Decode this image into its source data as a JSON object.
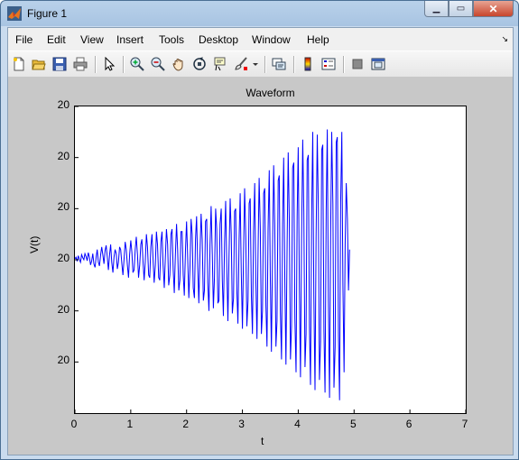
{
  "window": {
    "title": "Figure 1",
    "minimize_label": "▁",
    "maximize_label": "▭",
    "close_label": "✕"
  },
  "menu": {
    "items": [
      "File",
      "Edit",
      "View",
      "Insert",
      "Tools",
      "Desktop",
      "Window",
      "Help"
    ]
  },
  "toolbar": {
    "icons": [
      "new-figure-icon",
      "open-file-icon",
      "save-icon",
      "print-icon",
      "pointer-icon",
      "zoom-in-icon",
      "zoom-out-icon",
      "pan-icon",
      "rotate-3d-icon",
      "data-cursor-icon",
      "brush-icon",
      "link-plot-icon",
      "colorbar-icon",
      "legend-icon",
      "hide-plot-tools-icon",
      "show-plot-tools-icon"
    ]
  },
  "colors": {
    "line": "#0000ff",
    "figure_bg": "#c8c8c8",
    "axes_bg": "#ffffff"
  },
  "chart_data": {
    "type": "line",
    "title": "Waveform",
    "xlabel": "t",
    "ylabel": "V(t)",
    "xlim": [
      0,
      7
    ],
    "ylim": [
      -3,
      3
    ],
    "xticks": [
      "0",
      "1",
      "2",
      "3",
      "4",
      "5",
      "6",
      "7"
    ],
    "yticks": [
      "20",
      "20",
      "20",
      "20",
      "20",
      "20"
    ],
    "series": [
      {
        "color": "#0000ff",
        "x_start": 0,
        "x_step": 0.02,
        "values": [
          0.02,
          0.05,
          -0.03,
          0.08,
          0.01,
          -0.05,
          0.1,
          0.04,
          0.0,
          0.12,
          0.06,
          -0.02,
          0.14,
          0.05,
          -0.1,
          -0.02,
          0.12,
          -0.08,
          -0.15,
          0.05,
          0.2,
          -0.05,
          -0.12,
          0.1,
          0.25,
          0.1,
          -0.08,
          0.18,
          0.28,
          0.05,
          -0.2,
          0.1,
          0.3,
          -0.05,
          -0.25,
          0.05,
          0.2,
          0.12,
          -0.18,
          -0.05,
          0.25,
          0.2,
          -0.08,
          -0.3,
          0.0,
          0.35,
          0.2,
          -0.1,
          -0.35,
          0.1,
          0.38,
          0.15,
          -0.25,
          -0.2,
          0.2,
          0.45,
          0.1,
          -0.35,
          -0.1,
          0.3,
          0.4,
          -0.05,
          -0.4,
          -0.05,
          0.5,
          0.25,
          -0.3,
          -0.35,
          0.25,
          0.5,
          0.0,
          -0.45,
          -0.1,
          0.55,
          0.3,
          -0.35,
          -0.4,
          0.35,
          0.55,
          -0.1,
          -0.55,
          0.05,
          0.6,
          0.3,
          -0.5,
          -0.3,
          0.5,
          0.6,
          -0.2,
          -0.65,
          0.1,
          0.7,
          0.2,
          -0.6,
          -0.4,
          0.55,
          0.55,
          -0.3,
          -0.7,
          0.2,
          0.75,
          0.0,
          -0.75,
          -0.2,
          0.8,
          0.5,
          -0.55,
          -0.75,
          0.4,
          0.85,
          -0.15,
          -0.85,
          0.15,
          0.9,
          0.4,
          -0.8,
          -0.6,
          0.75,
          0.8,
          -0.45,
          -1.0,
          0.3,
          1.05,
          0.1,
          -0.95,
          -0.35,
          1.0,
          0.6,
          -0.85,
          -0.8,
          0.7,
          1.0,
          -0.4,
          -1.1,
          0.35,
          1.15,
          -0.2,
          -1.2,
          0.05,
          1.2,
          0.5,
          -1.05,
          -0.75,
          0.95,
          1.0,
          -0.6,
          -1.25,
          0.4,
          1.3,
          -0.25,
          -1.35,
          0.1,
          1.4,
          0.45,
          -1.3,
          -0.8,
          1.1,
          1.2,
          -0.7,
          -1.45,
          0.55,
          1.5,
          -0.35,
          -1.55,
          0.15,
          1.6,
          0.6,
          -1.45,
          -1.0,
          1.3,
          1.4,
          -0.9,
          -1.7,
          0.6,
          1.75,
          -0.4,
          -1.8,
          0.25,
          1.85,
          0.7,
          -1.7,
          -1.2,
          1.55,
          1.65,
          -1.0,
          -1.95,
          0.7,
          2.0,
          -0.45,
          -2.05,
          0.3,
          2.1,
          0.8,
          -1.95,
          -1.3,
          1.8,
          1.9,
          -1.15,
          -2.2,
          0.85,
          2.2,
          -0.6,
          -2.3,
          0.4,
          2.35,
          0.95,
          -2.1,
          -1.45,
          1.95,
          2.05,
          -1.3,
          -2.45,
          0.9,
          2.5,
          -0.7,
          -2.55,
          0.45,
          2.45,
          1.0,
          -2.35,
          -1.6,
          2.15,
          2.25,
          -1.4,
          -2.6,
          1.0,
          2.55,
          -0.8,
          -2.7,
          0.5,
          2.5,
          1.1,
          -2.5,
          -1.7,
          2.3,
          2.4,
          -1.5,
          -2.75,
          1.1,
          2.5,
          -0.5,
          -2.2,
          0.3,
          1.5,
          0.8,
          -0.6,
          0.2
        ]
      }
    ]
  }
}
